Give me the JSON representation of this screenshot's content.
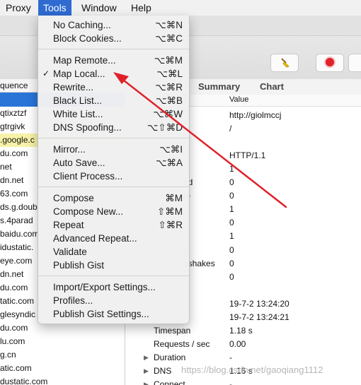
{
  "menubar": {
    "items": [
      "Proxy",
      "Tools",
      "Window",
      "Help"
    ]
  },
  "toolbar": {
    "broom_icon": "broom-icon",
    "record_icon": "record-icon"
  },
  "left_pane": {
    "header": "quence",
    "rows": [
      "qtixztzf",
      "gtrgivk",
      ".google.c",
      "du.com",
      "net",
      "dn.net",
      "63.com",
      "ds.g.doub",
      "s.4parad",
      "baidu.com",
      "idustatic.",
      "eye.com",
      "dn.net",
      "du.com",
      "tatic.com",
      "glesyndic",
      "du.com",
      "lu.com",
      "g.cn",
      "atic.com",
      "dustatic.com"
    ]
  },
  "right_pane": {
    "tabs": [
      "Summary",
      "Chart"
    ],
    "column_value": "Value",
    "rows": [
      {
        "name": "",
        "value": "http://giolmccj"
      },
      {
        "name": "",
        "value": "/"
      },
      {
        "name": "",
        "value": ""
      },
      {
        "name": "",
        "value": "HTTP/1.1"
      },
      {
        "name": "",
        "value": "1"
      },
      {
        "name": "ed",
        "value": "0"
      },
      {
        "name": "te",
        "value": "0"
      },
      {
        "name": "",
        "value": "1"
      },
      {
        "name": "",
        "value": "0"
      },
      {
        "name": "",
        "value": "1"
      },
      {
        "name": "s",
        "value": "0"
      },
      {
        "name": "dshakes",
        "value": "0"
      },
      {
        "name": "",
        "value": "0"
      },
      {
        "name": "",
        "value": ""
      },
      {
        "name": "",
        "value": "19-7-2 13:24:20"
      },
      {
        "name": "",
        "value": "19-7-2 13:24:21"
      },
      {
        "name": "Timespan",
        "value": "1.18 s"
      },
      {
        "name": "Requests / sec",
        "value": "0.00"
      },
      {
        "name": "Duration",
        "value": "-"
      },
      {
        "name": "DNS",
        "value": "1.16 s"
      },
      {
        "name": "Connect",
        "value": "-"
      }
    ]
  },
  "menu": {
    "groups": [
      [
        {
          "label": "No Caching...",
          "shortcut": "⌥⌘N"
        },
        {
          "label": "Block Cookies...",
          "shortcut": "⌥⌘C"
        }
      ],
      [
        {
          "label": "Map Remote...",
          "shortcut": "⌥⌘M"
        },
        {
          "label": "Map Local...",
          "shortcut": "⌥⌘L",
          "checked": true
        },
        {
          "label": "Rewrite...",
          "shortcut": "⌥⌘R"
        },
        {
          "label": "Black List...",
          "shortcut": "⌥⌘B"
        },
        {
          "label": "White List...",
          "shortcut": "⌥⌘W"
        },
        {
          "label": "DNS Spoofing...",
          "shortcut": "⌥⇧⌘D"
        }
      ],
      [
        {
          "label": "Mirror...",
          "shortcut": "⌥⌘I"
        },
        {
          "label": "Auto Save...",
          "shortcut": "⌥⌘A"
        },
        {
          "label": "Client Process...",
          "shortcut": ""
        }
      ],
      [
        {
          "label": "Compose",
          "shortcut": "⌘M"
        },
        {
          "label": "Compose New...",
          "shortcut": "⇧⌘M"
        },
        {
          "label": "Repeat",
          "shortcut": "⇧⌘R"
        },
        {
          "label": "Advanced Repeat...",
          "shortcut": ""
        },
        {
          "label": "Validate",
          "shortcut": ""
        },
        {
          "label": "Publish Gist",
          "shortcut": ""
        }
      ],
      [
        {
          "label": "Import/Export Settings...",
          "shortcut": ""
        },
        {
          "label": "Profiles...",
          "shortcut": ""
        },
        {
          "label": "Publish Gist Settings...",
          "shortcut": ""
        }
      ]
    ],
    "check_mark": "✓"
  },
  "watermark": "https://blog.csdn.net/gaoqiang1112",
  "colors": {
    "menu_active": "#2f6bd1",
    "selection": "#2a74d8",
    "arrow": "#e0202a"
  }
}
